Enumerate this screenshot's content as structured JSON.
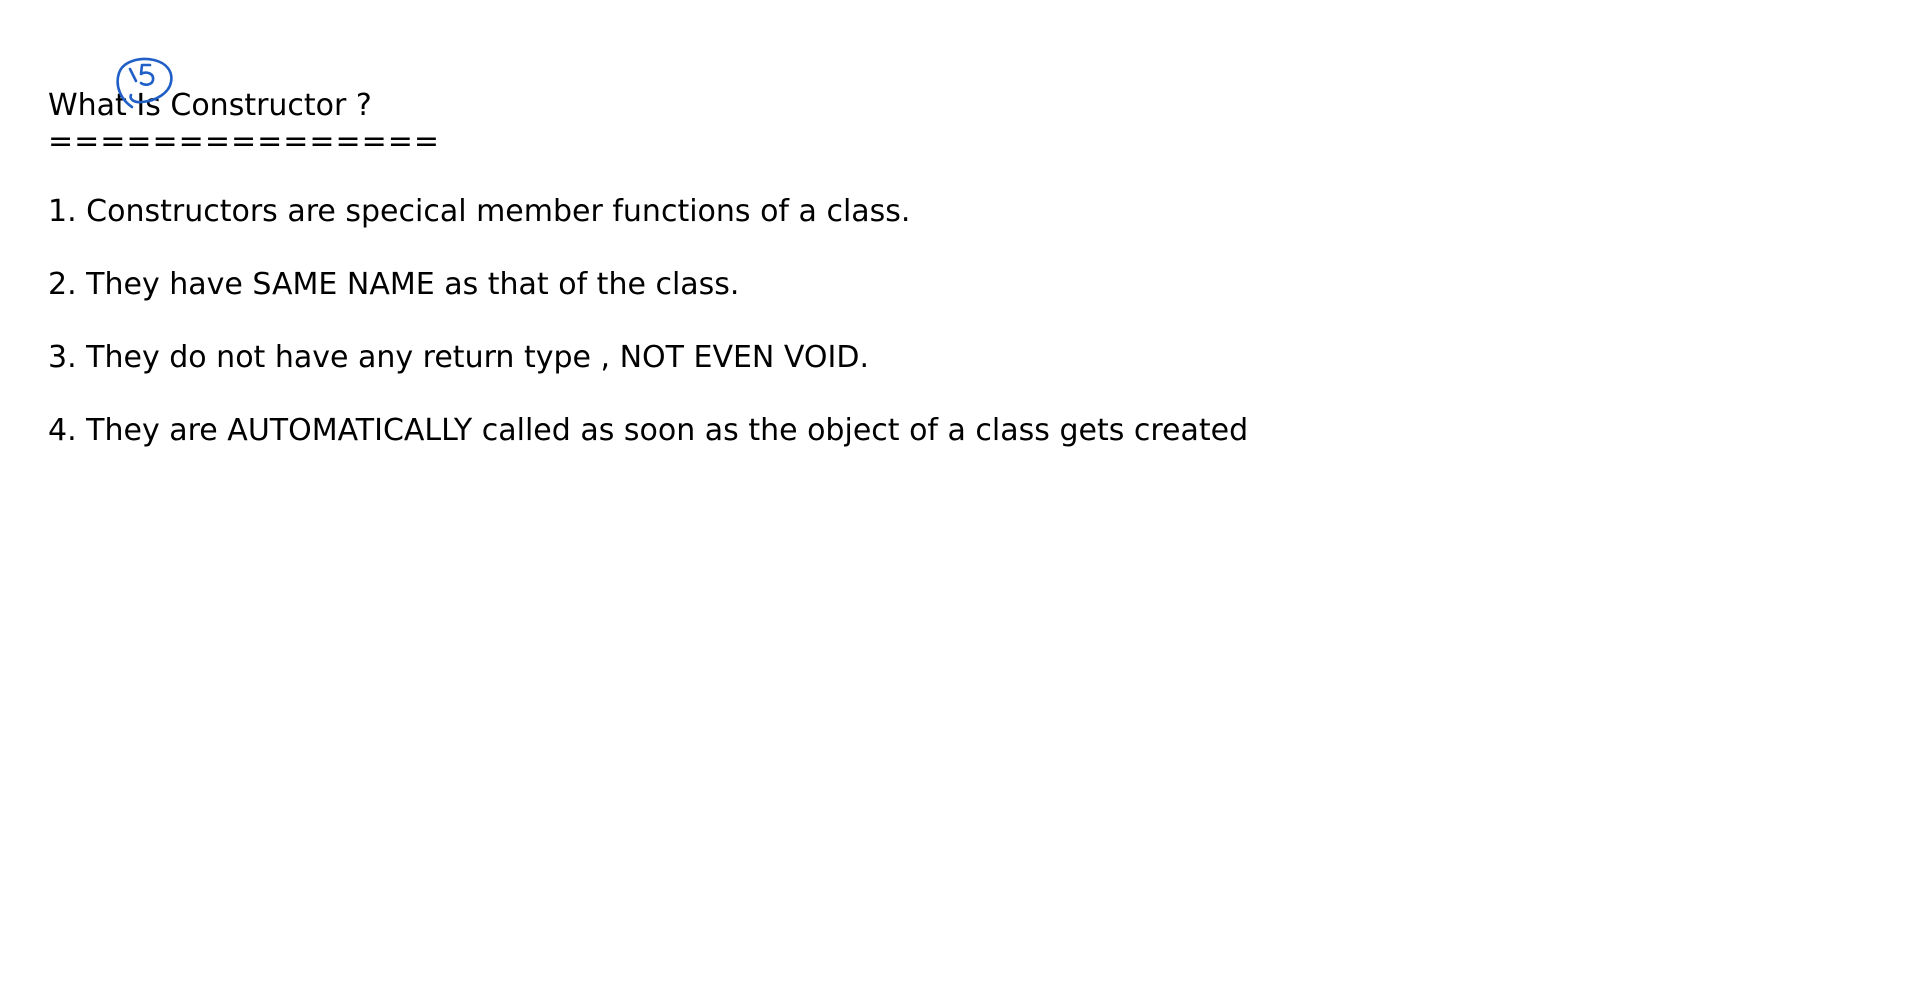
{
  "document": {
    "title": "What Is Constructor ?",
    "underline": "===============",
    "points": [
      "1. Constructors are specical member functions of a class.",
      "2. They have SAME NAME as that of the class.",
      "3. They do not have any return type , NOT EVEN VOID.",
      "4. They are AUTOMATICALLY called as soon as the object of a class gets created"
    ]
  },
  "annotation": {
    "ink_color": "#1f5fc7"
  }
}
